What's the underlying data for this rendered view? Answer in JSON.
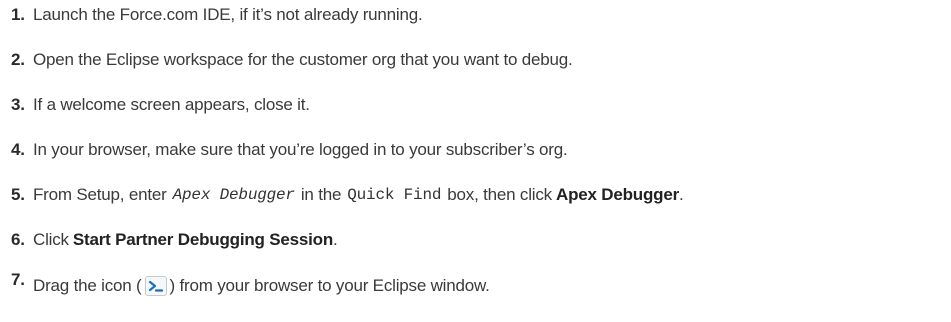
{
  "steps": [
    {
      "number": "1.",
      "text": "Launch the Force.com IDE, if it’s not already running."
    },
    {
      "number": "2.",
      "text": "Open the Eclipse workspace for the customer org that you want to debug."
    },
    {
      "number": "3.",
      "text": "If a welcome screen appears, close it."
    },
    {
      "number": "4.",
      "text": "In your browser, make sure that you’re logged in to your subscriber’s org."
    },
    {
      "number": "5.",
      "pre": "From Setup, enter",
      "code_italic": "Apex Debugger",
      "mid": "in the",
      "code": "Quick Find",
      "post": "box, then click",
      "bold": "Apex Debugger",
      "end": "."
    },
    {
      "number": "6.",
      "pre": "Click",
      "bold": "Start Partner Debugging Session",
      "end": "."
    },
    {
      "number": "7.",
      "pre": "Drag the icon (",
      "icon": "terminal-prompt-icon",
      "post": ") from your browser to your Eclipse window."
    }
  ],
  "colors": {
    "text": "#3a3a3a",
    "icon_accent": "#1b6fb5"
  }
}
